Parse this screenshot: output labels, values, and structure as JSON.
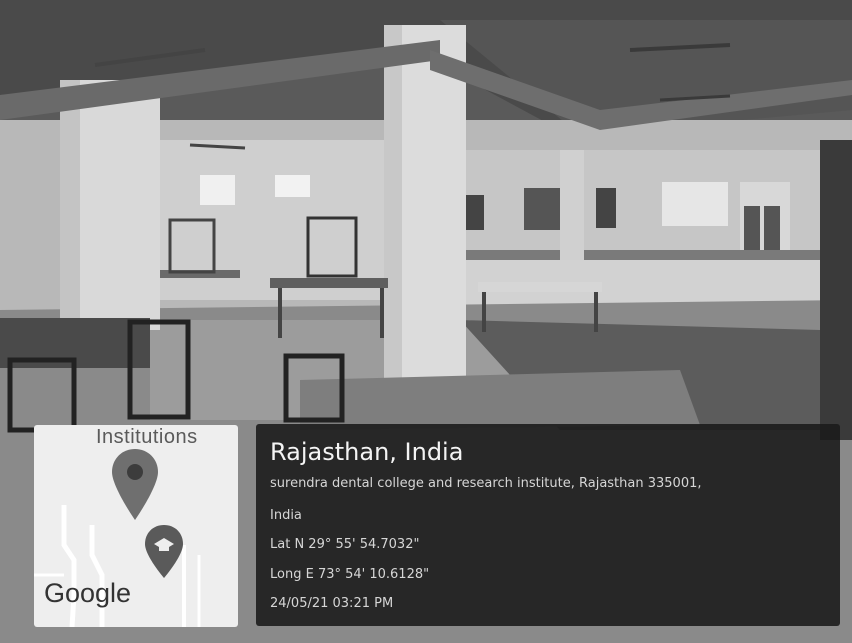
{
  "map": {
    "label": "Institutions",
    "google_logo": "Google",
    "pin_icon": "map-pin-icon",
    "education_icon": "graduation-cap-icon"
  },
  "geotag": {
    "place": "Rajasthan, India",
    "address_line1": "surendra dental college and research institute, Rajasthan 335001,",
    "address_line2": "India",
    "lat": "Lat N 29° 55' 54.7032\"",
    "long": "Long E 73° 54' 10.6128\"",
    "datetime": "24/05/21 03:21 PM"
  },
  "colors": {
    "pin_red": "#7a7a7a",
    "card_bg": "#1c1c1c"
  }
}
